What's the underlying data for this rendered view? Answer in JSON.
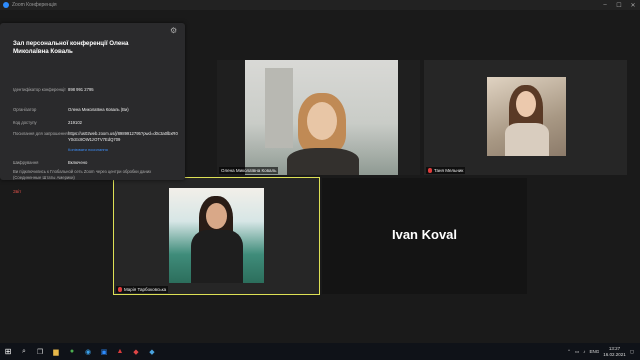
{
  "window": {
    "title": "Zoom Конференція"
  },
  "info_panel": {
    "title": "Зал персональної конференції Олена Миколаївна Коваль",
    "rows": [
      {
        "key": "Ідентифікатор конференції",
        "value": "898 991 2795"
      },
      {
        "key": "Організатор",
        "value": "Олена Миколаївна Коваль (Ви)"
      },
      {
        "key": "Код доступу",
        "value": "219102"
      },
      {
        "key": "Посилання для запрошення",
        "value": "https://us02web.zoom.us/j/8989912795?pwd=d0c3a0lbxR0Y0cEc8OW1zOTV7EdQ709"
      },
      {
        "key": "Шифрування",
        "value": "Включено"
      }
    ],
    "copy_link": "Копіювати посилання",
    "note": "Ви підключились к Глобальной сеть Zoom через центри обробки даних (Соединенные Штаты Америки)",
    "report": "Звіт"
  },
  "participants": {
    "olena": {
      "name": "Олена Миколаївна Коваль"
    },
    "tanya": {
      "name": "Таня Мельник"
    },
    "maria": {
      "name": "Марія Тарбоковська"
    },
    "ivan": {
      "name": "Ivan Koval"
    }
  },
  "taskbar": {
    "language": "ENG",
    "time": "13:27",
    "date": "16.02.2021"
  }
}
